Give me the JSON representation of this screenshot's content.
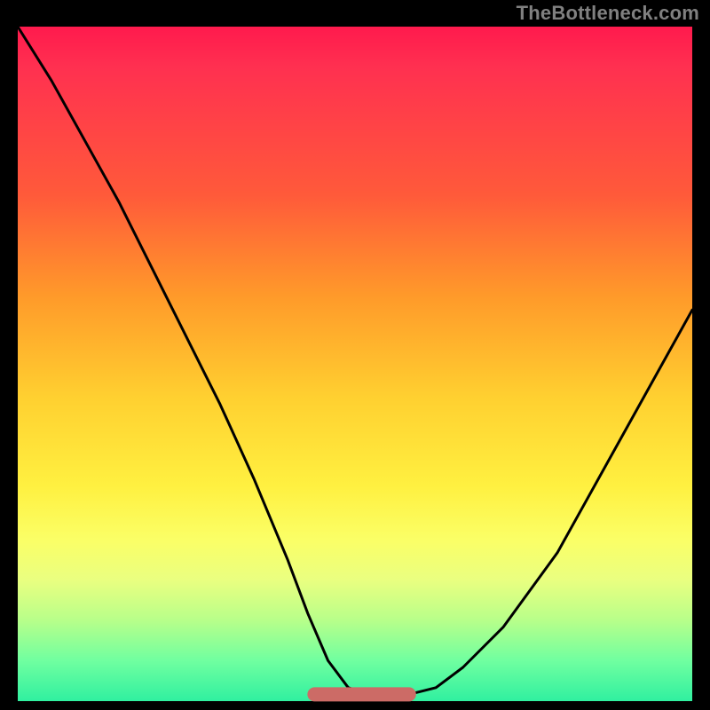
{
  "watermark": "TheBottleneck.com",
  "chart_data": {
    "type": "line",
    "title": "",
    "xlabel": "",
    "ylabel": "",
    "xlim": [
      0,
      100
    ],
    "ylim": [
      0,
      100
    ],
    "x": [
      0,
      5,
      10,
      15,
      20,
      25,
      30,
      35,
      40,
      43,
      46,
      49,
      52,
      55,
      58,
      62,
      66,
      72,
      80,
      90,
      100
    ],
    "values": [
      100,
      92,
      83,
      74,
      64,
      54,
      44,
      33,
      21,
      13,
      6,
      2,
      1,
      1,
      1,
      2,
      5,
      11,
      22,
      40,
      58
    ],
    "flat_region": {
      "x_start": 44,
      "x_end": 58,
      "y": 1
    },
    "grid": false,
    "legend": false,
    "background_gradient": {
      "direction": "vertical",
      "stops": [
        {
          "pos": 0.0,
          "color": "#ff1a4d"
        },
        {
          "pos": 0.25,
          "color": "#ff5a3a"
        },
        {
          "pos": 0.55,
          "color": "#ffd030"
        },
        {
          "pos": 0.78,
          "color": "#fbff66"
        },
        {
          "pos": 0.92,
          "color": "#8affa0"
        },
        {
          "pos": 1.0,
          "color": "#30f0a0"
        }
      ]
    }
  }
}
